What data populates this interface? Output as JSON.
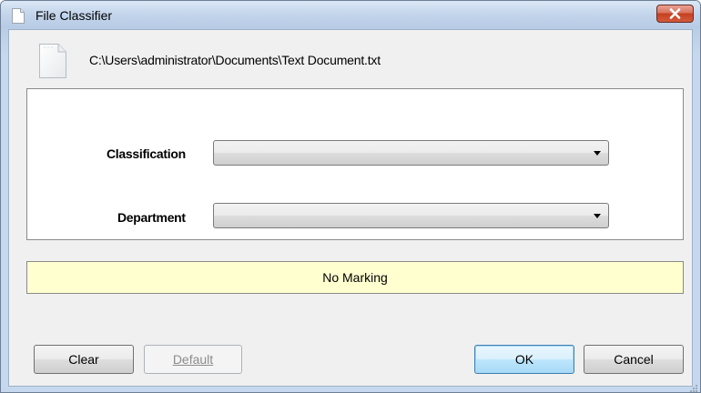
{
  "window": {
    "title": "File Classifier",
    "file_path": "C:\\Users\\administrator\\Documents\\Text Document.txt"
  },
  "fields": {
    "classification": {
      "label": "Classification",
      "value": ""
    },
    "department": {
      "label": "Department",
      "value": ""
    }
  },
  "marking": {
    "text": "No Marking",
    "background": "#ffffd0"
  },
  "buttons": {
    "clear": "Clear",
    "default": "Default",
    "ok": "OK",
    "cancel": "Cancel"
  },
  "icons": {
    "title": "document-icon",
    "close": "close-icon",
    "file": "text-file-icon",
    "dropdown": "chevron-down-icon",
    "grip": "resize-grip-icon"
  },
  "colors": {
    "close_button": "#c4401f",
    "marking_background": "#ffffd0",
    "default_button_border": "#3c7fb1"
  }
}
